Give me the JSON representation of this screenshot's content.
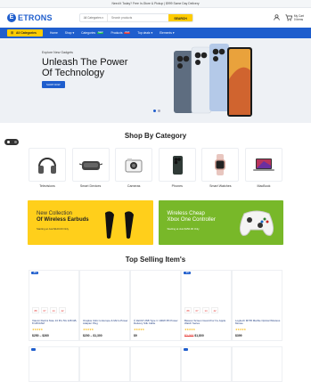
{
  "topbar": {
    "text": "Need it Today? Free In-Store & Pickup | $999 Same Day Delivery"
  },
  "header": {
    "logo_text": "ETRONS",
    "logo_letter": "E",
    "search_category": "All Categories",
    "search_placeholder": "Search products",
    "search_button": "SEARCH",
    "cart_label": "My Cart",
    "cart_count": "0",
    "cart_items": "0 items"
  },
  "nav": {
    "all_categories": "All Categories",
    "items": [
      {
        "label": "Home",
        "badge": ""
      },
      {
        "label": "Shop",
        "badge": ""
      },
      {
        "label": "Categories",
        "badge": "NEW"
      },
      {
        "label": "Products",
        "badge": "HOT"
      },
      {
        "label": "Top deals",
        "badge": ""
      },
      {
        "label": "Elements",
        "badge": ""
      }
    ]
  },
  "hero": {
    "small": "Explore New Gadgets",
    "title": "Unleash The Power Of Technology",
    "button": "SHOP NOW"
  },
  "categories": {
    "title": "Shop By Category",
    "items": [
      {
        "label": "Televisions",
        "icon": "headphones-icon"
      },
      {
        "label": "Smart Devices",
        "icon": "vr-headset-icon"
      },
      {
        "label": "Cameras",
        "icon": "camera-icon"
      },
      {
        "label": "Phones",
        "icon": "phone-icon"
      },
      {
        "label": "Smart Watches",
        "icon": "watch-icon"
      },
      {
        "label": "MacBook",
        "icon": "laptop-icon"
      }
    ]
  },
  "banners": [
    {
      "line1": "New Collection",
      "line2": "Of Wireless Earbuds",
      "line3": "Starting at Just $120.00 Only"
    },
    {
      "line1": "Wireless Cheap",
      "line2": "Xbox One Controller",
      "line3": "Starting at Just $150.00 Only"
    }
  ],
  "top_selling": {
    "title": "Top Selling Item's",
    "products": [
      {
        "tag": "-8%",
        "name": "Xiaomi Redmi Note 13 Pro 5G 128 GB, 8 GB RAM",
        "stars": "★★★★★",
        "old": "",
        "price": "$250 – $260",
        "timer": [
          "88",
          "07",
          "14",
          "42"
        ]
      },
      {
        "tag": "",
        "name": "Oraplus Usbc to Europe & Micro Power Adapter Plug",
        "stars": "★★★★★",
        "old": "",
        "price": "$200 – $1,300",
        "timer": []
      },
      {
        "tag": "",
        "name": "Á 1ECM USB Type C 100W PD Power Delivery Silk Cable",
        "stars": "★★★★★",
        "old": "",
        "price": "$9",
        "timer": []
      },
      {
        "tag": "-9%",
        "name": "Baseus Screen Guard For N+ Apple Watch Series",
        "stars": "★★★★★",
        "old": "$2,000",
        "price": "$1,800",
        "timer": [
          "88",
          "07",
          "14",
          "42"
        ]
      },
      {
        "tag": "",
        "name": "Logitech M705 Marble Optical Wireless Mouse",
        "stars": "★★★★★",
        "old": "",
        "price": "$399",
        "timer": []
      }
    ]
  },
  "colors": {
    "primary": "#1f5ecd",
    "accent": "#ffcc00",
    "green": "#78b829"
  }
}
